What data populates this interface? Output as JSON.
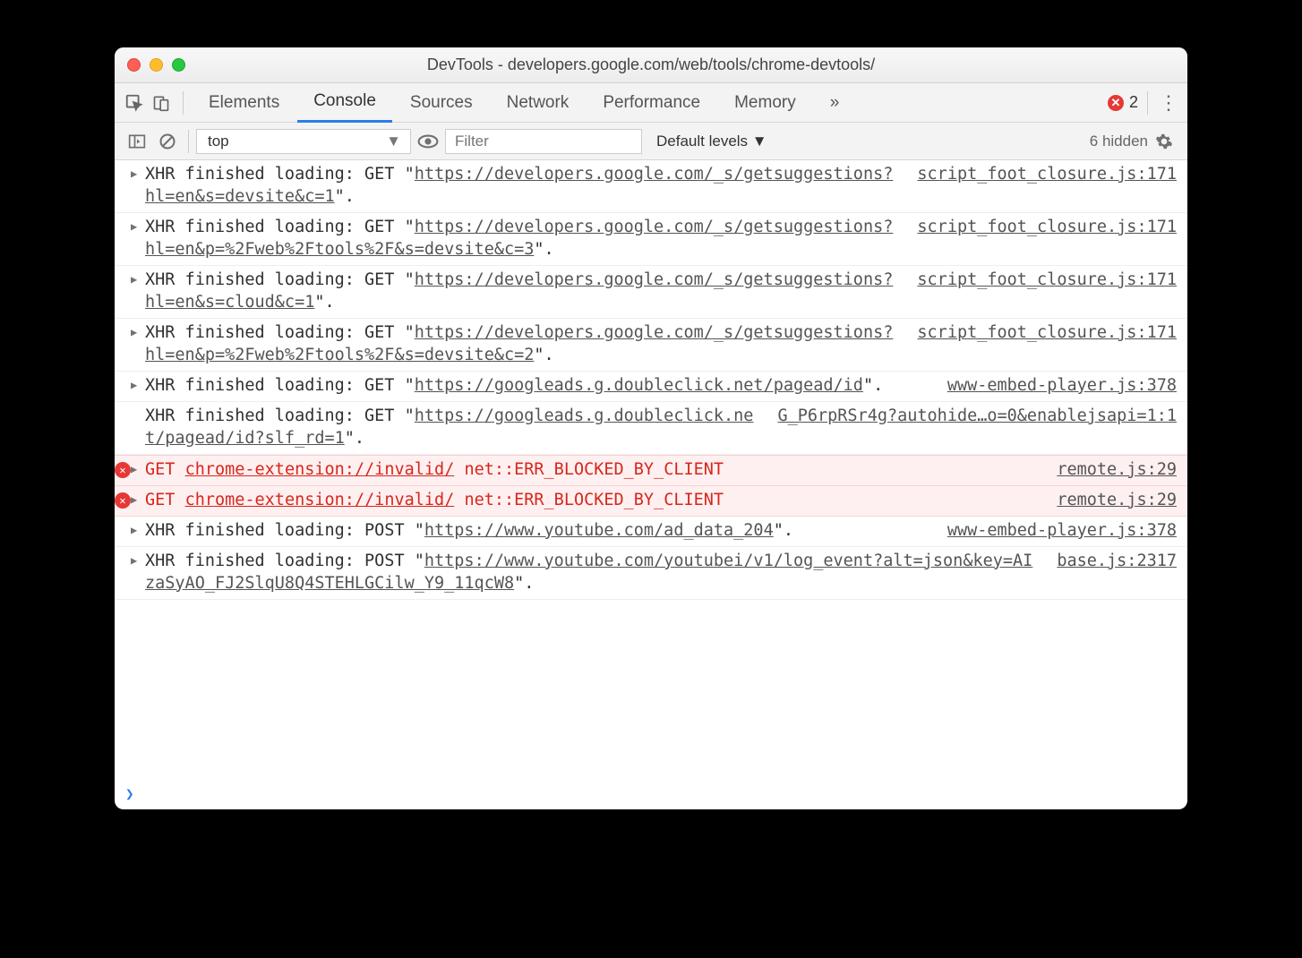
{
  "window": {
    "title": "DevTools - developers.google.com/web/tools/chrome-devtools/"
  },
  "tabs": {
    "items": [
      "Elements",
      "Console",
      "Sources",
      "Network",
      "Performance",
      "Memory"
    ],
    "active": 1,
    "overflow": "»",
    "error_count": "2"
  },
  "toolbar": {
    "context": "top",
    "filter_placeholder": "Filter",
    "levels": "Default levels ▼",
    "hidden": "6 hidden"
  },
  "messages": [
    {
      "type": "xhr",
      "disclose": true,
      "prefix": "XHR finished loading: GET \"",
      "url": "https://developers.google.com/_s/getsuggestions?hl=en&s=devsite&c=1",
      "suffix": "\".",
      "source": "script_foot_closure.js:171"
    },
    {
      "type": "xhr",
      "disclose": true,
      "prefix": "XHR finished loading: GET \"",
      "url": "https://developers.google.com/_s/getsuggestions?hl=en&p=%2Fweb%2Ftools%2F&s=devsite&c=3",
      "suffix": "\".",
      "source": "script_foot_closure.js:171"
    },
    {
      "type": "xhr",
      "disclose": true,
      "prefix": "XHR finished loading: GET \"",
      "url": "https://developers.google.com/_s/getsuggestions?hl=en&s=cloud&c=1",
      "suffix": "\".",
      "source": "script_foot_closure.js:171"
    },
    {
      "type": "xhr",
      "disclose": true,
      "prefix": "XHR finished loading: GET \"",
      "url": "https://developers.google.com/_s/getsuggestions?hl=en&p=%2Fweb%2Ftools%2F&s=devsite&c=2",
      "suffix": "\".",
      "source": "script_foot_closure.js:171"
    },
    {
      "type": "xhr",
      "disclose": true,
      "prefix": "XHR finished loading: GET \"",
      "url": "https://googleads.g.doubleclick.net/pagead/id",
      "suffix": "\".",
      "source": "www-embed-player.js:378"
    },
    {
      "type": "xhr",
      "disclose": false,
      "prefix": "XHR finished loading: GET \"",
      "url": "https://googleads.g.doubleclick.net/pagead/id?slf_rd=1",
      "suffix": "\".",
      "source": "G_P6rpRSr4g?autohide…o=0&enablejsapi=1:1"
    },
    {
      "type": "error",
      "disclose": true,
      "method": "GET",
      "url": "chrome-extension://invalid/",
      "err": "net::ERR_BLOCKED_BY_CLIENT",
      "source": "remote.js:29"
    },
    {
      "type": "error",
      "disclose": true,
      "method": "GET",
      "url": "chrome-extension://invalid/",
      "err": "net::ERR_BLOCKED_BY_CLIENT",
      "source": "remote.js:29"
    },
    {
      "type": "xhr",
      "disclose": true,
      "prefix": "XHR finished loading: POST \"",
      "url": "https://www.youtube.com/ad_data_204",
      "suffix": "\".",
      "source": "www-embed-player.js:378"
    },
    {
      "type": "xhr",
      "disclose": true,
      "prefix": "XHR finished loading: POST \"",
      "url": "https://www.youtube.com/youtubei/v1/log_event?alt=json&key=AIzaSyAO_FJ2SlqU8Q4STEHLGCilw_Y9_11qcW8",
      "suffix": "\".",
      "source": "base.js:2317"
    }
  ],
  "prompt": "❯"
}
